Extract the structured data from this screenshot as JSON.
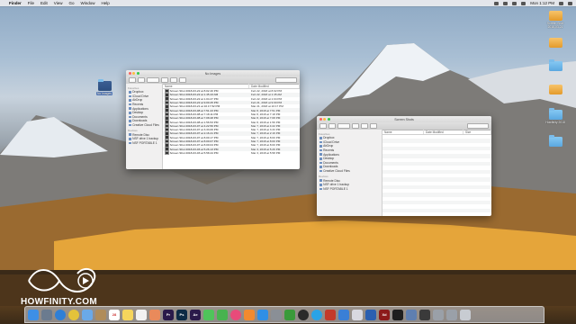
{
  "menubar": {
    "apple": "",
    "app": "Finder",
    "items": [
      "File",
      "Edit",
      "View",
      "Go",
      "Window",
      "Help"
    ],
    "clock": "Mon 1:12 PM"
  },
  "desktop": {
    "selected_icon_label": "No Images",
    "icons": [
      {
        "label": "Screen Shot 2018-03-21",
        "kind": "drive"
      },
      {
        "label": "",
        "kind": "drive"
      },
      {
        "label": "",
        "kind": "folder"
      },
      {
        "label": "",
        "kind": "drive"
      },
      {
        "label": "Howfinity 2018",
        "kind": "folder"
      },
      {
        "label": "",
        "kind": "folder"
      }
    ]
  },
  "window1": {
    "title": "No Images",
    "sidebar": {
      "favorites_header": "Favorites",
      "favorites": [
        "Dropbox",
        "iCloud Drive",
        "AirDrop",
        "Recents",
        "Applications",
        "Desktop",
        "Documents",
        "Downloads",
        "Creative Cloud Files"
      ],
      "devices_header": "Devices",
      "devices": [
        "Remote Disc",
        "NSF drive 1 backup",
        "NSF PORTABLE 1"
      ]
    },
    "columns": {
      "name": "Name",
      "date": "Date Modified"
    },
    "files": [
      {
        "name": "Screen Shot 2018-03-22 at 8.02.40 PM",
        "date": "Feb 22, 2018 at 8:02 PM"
      },
      {
        "name": "Screen Shot 2018-03-22 at 1.45.43 AM",
        "date": "Feb 22, 2018 at 1:45 AM"
      },
      {
        "name": "Screen Shot 2018-03-22 at 1.04.47 PM",
        "date": "Feb 22, 2018 at 1:04 PM"
      },
      {
        "name": "Screen Shot 2018-03-22 at 9.00.25 PM",
        "date": "Feb 21, 2018 at 9:00 PM"
      },
      {
        "name": "Screen Shot 2018-03-21 at 10.17.52 PM",
        "date": "Mar 21, 2018 at 10:17 PM"
      },
      {
        "name": "Screen Shot 2018-03-08 at 7.51.23 PM",
        "date": "Mar 8, 2018 at 7:51 PM"
      },
      {
        "name": "Screen Shot 2018-03-08 at 7.18.11 PM",
        "date": "Mar 8, 2018 at 7:18 PM"
      },
      {
        "name": "Screen Shot 2018-03-08 at 7.08.28 PM",
        "date": "Mar 8, 2018 at 7:08 PM"
      },
      {
        "name": "Screen Shot 2018-03-08 at 1.56.53 PM",
        "date": "Mar 8, 2018 at 1:56 PM"
      },
      {
        "name": "Screen Shot 2018-03-07 at 4.22.56 PM",
        "date": "Mar 7, 2018 at 4:22 PM"
      },
      {
        "name": "Screen Shot 2018-03-07 at 3.33.06 PM",
        "date": "Mar 7, 2018 at 3:33 PM"
      },
      {
        "name": "Screen Shot 2018-03-07 at 2.16.41 PM",
        "date": "Mar 7, 2018 at 2:16 PM"
      },
      {
        "name": "Screen Shot 2018-03-07 at 8.00.17 PM",
        "date": "Mar 7, 2018 at 8:00 PM"
      },
      {
        "name": "Screen Shot 2018-03-07 at 8.00.07 PM",
        "date": "Mar 7, 2018 at 8:00 PM"
      },
      {
        "name": "Screen Shot 2018-03-07 at 8.00.04 PM",
        "date": "Mar 7, 2018 at 8:00 PM"
      },
      {
        "name": "Screen Shot 2018-03-03 at 5.26.13 PM",
        "date": "Mar 3, 2018 at 5:26 PM"
      },
      {
        "name": "Screen Shot 2018-03-03 at 5.58.44 PM",
        "date": "Mar 3, 2018 at 5:58 PM"
      }
    ]
  },
  "window2": {
    "title": "Screen Shots",
    "sidebar": {
      "favorites_header": "Favorites",
      "favorites": [
        "Dropbox",
        "iCloud Drive",
        "AirDrop",
        "Recents",
        "Applications",
        "Desktop",
        "Documents",
        "Downloads",
        "Creative Cloud Files"
      ],
      "devices_header": "Devices",
      "devices": [
        "Remote Disc",
        "NSF drive 1 backup",
        "NSF PORTABLE 1"
      ]
    },
    "columns": {
      "name": "Name",
      "date": "Date Modified",
      "size": "Size"
    }
  },
  "watermark": {
    "text": "HOWFINITY.COM"
  },
  "dock": {
    "apps": [
      {
        "name": "finder",
        "color": "#3d8fe6",
        "glyph": ""
      },
      {
        "name": "launchpad",
        "color": "#6b7b8f",
        "glyph": ""
      },
      {
        "name": "safari",
        "color": "#2f7fd6",
        "glyph": ""
      },
      {
        "name": "chrome",
        "color": "#e3c23a",
        "glyph": ""
      },
      {
        "name": "mail",
        "color": "#6aa9e8",
        "glyph": ""
      },
      {
        "name": "contacts",
        "color": "#b08c5a",
        "glyph": ""
      },
      {
        "name": "calendar",
        "color": "#ffffff",
        "glyph": "28"
      },
      {
        "name": "notes",
        "color": "#f6d55c",
        "glyph": ""
      },
      {
        "name": "reminders",
        "color": "#f2f2f2",
        "glyph": ""
      },
      {
        "name": "photos",
        "color": "#e98a5b",
        "glyph": ""
      },
      {
        "name": "premiere",
        "color": "#2a1a4a",
        "glyph": "Pr"
      },
      {
        "name": "photoshop",
        "color": "#0d2b45",
        "glyph": "Ps"
      },
      {
        "name": "after-effects",
        "color": "#2b1a4a",
        "glyph": "Ae"
      },
      {
        "name": "messages",
        "color": "#4fc45a",
        "glyph": ""
      },
      {
        "name": "facetime",
        "color": "#47b34f",
        "glyph": ""
      },
      {
        "name": "itunes",
        "color": "#e84b7a",
        "glyph": ""
      },
      {
        "name": "ibooks",
        "color": "#f28a2e",
        "glyph": ""
      },
      {
        "name": "app-store",
        "color": "#2f8fe6",
        "glyph": ""
      },
      {
        "name": "system-preferences",
        "color": "#8a8f96",
        "glyph": ""
      },
      {
        "name": "camtasia",
        "color": "#3a9a3a",
        "glyph": ""
      },
      {
        "name": "obs",
        "color": "#2a2a2a",
        "glyph": ""
      },
      {
        "name": "skype",
        "color": "#2aa3e6",
        "glyph": ""
      },
      {
        "name": "filezilla",
        "color": "#c43a2a",
        "glyph": ""
      },
      {
        "name": "keynote",
        "color": "#3a7fd6",
        "glyph": ""
      },
      {
        "name": "xd-app",
        "color": "#d8d8e0",
        "glyph": ""
      },
      {
        "name": "word",
        "color": "#2b5fb0",
        "glyph": ""
      },
      {
        "name": "acrobat",
        "color": "#8c1a1a",
        "glyph": "Xd"
      },
      {
        "name": "terminal",
        "color": "#1e1e1e",
        "glyph": ""
      },
      {
        "name": "preview",
        "color": "#5f7fb0",
        "glyph": ""
      },
      {
        "name": "activity-monitor",
        "color": "#3a3a3a",
        "glyph": ""
      },
      {
        "name": "downloads",
        "color": "#9aa0a8",
        "glyph": ""
      },
      {
        "name": "documents",
        "color": "#9aa0a8",
        "glyph": ""
      },
      {
        "name": "trash",
        "color": "#c8ccd2",
        "glyph": ""
      }
    ]
  }
}
